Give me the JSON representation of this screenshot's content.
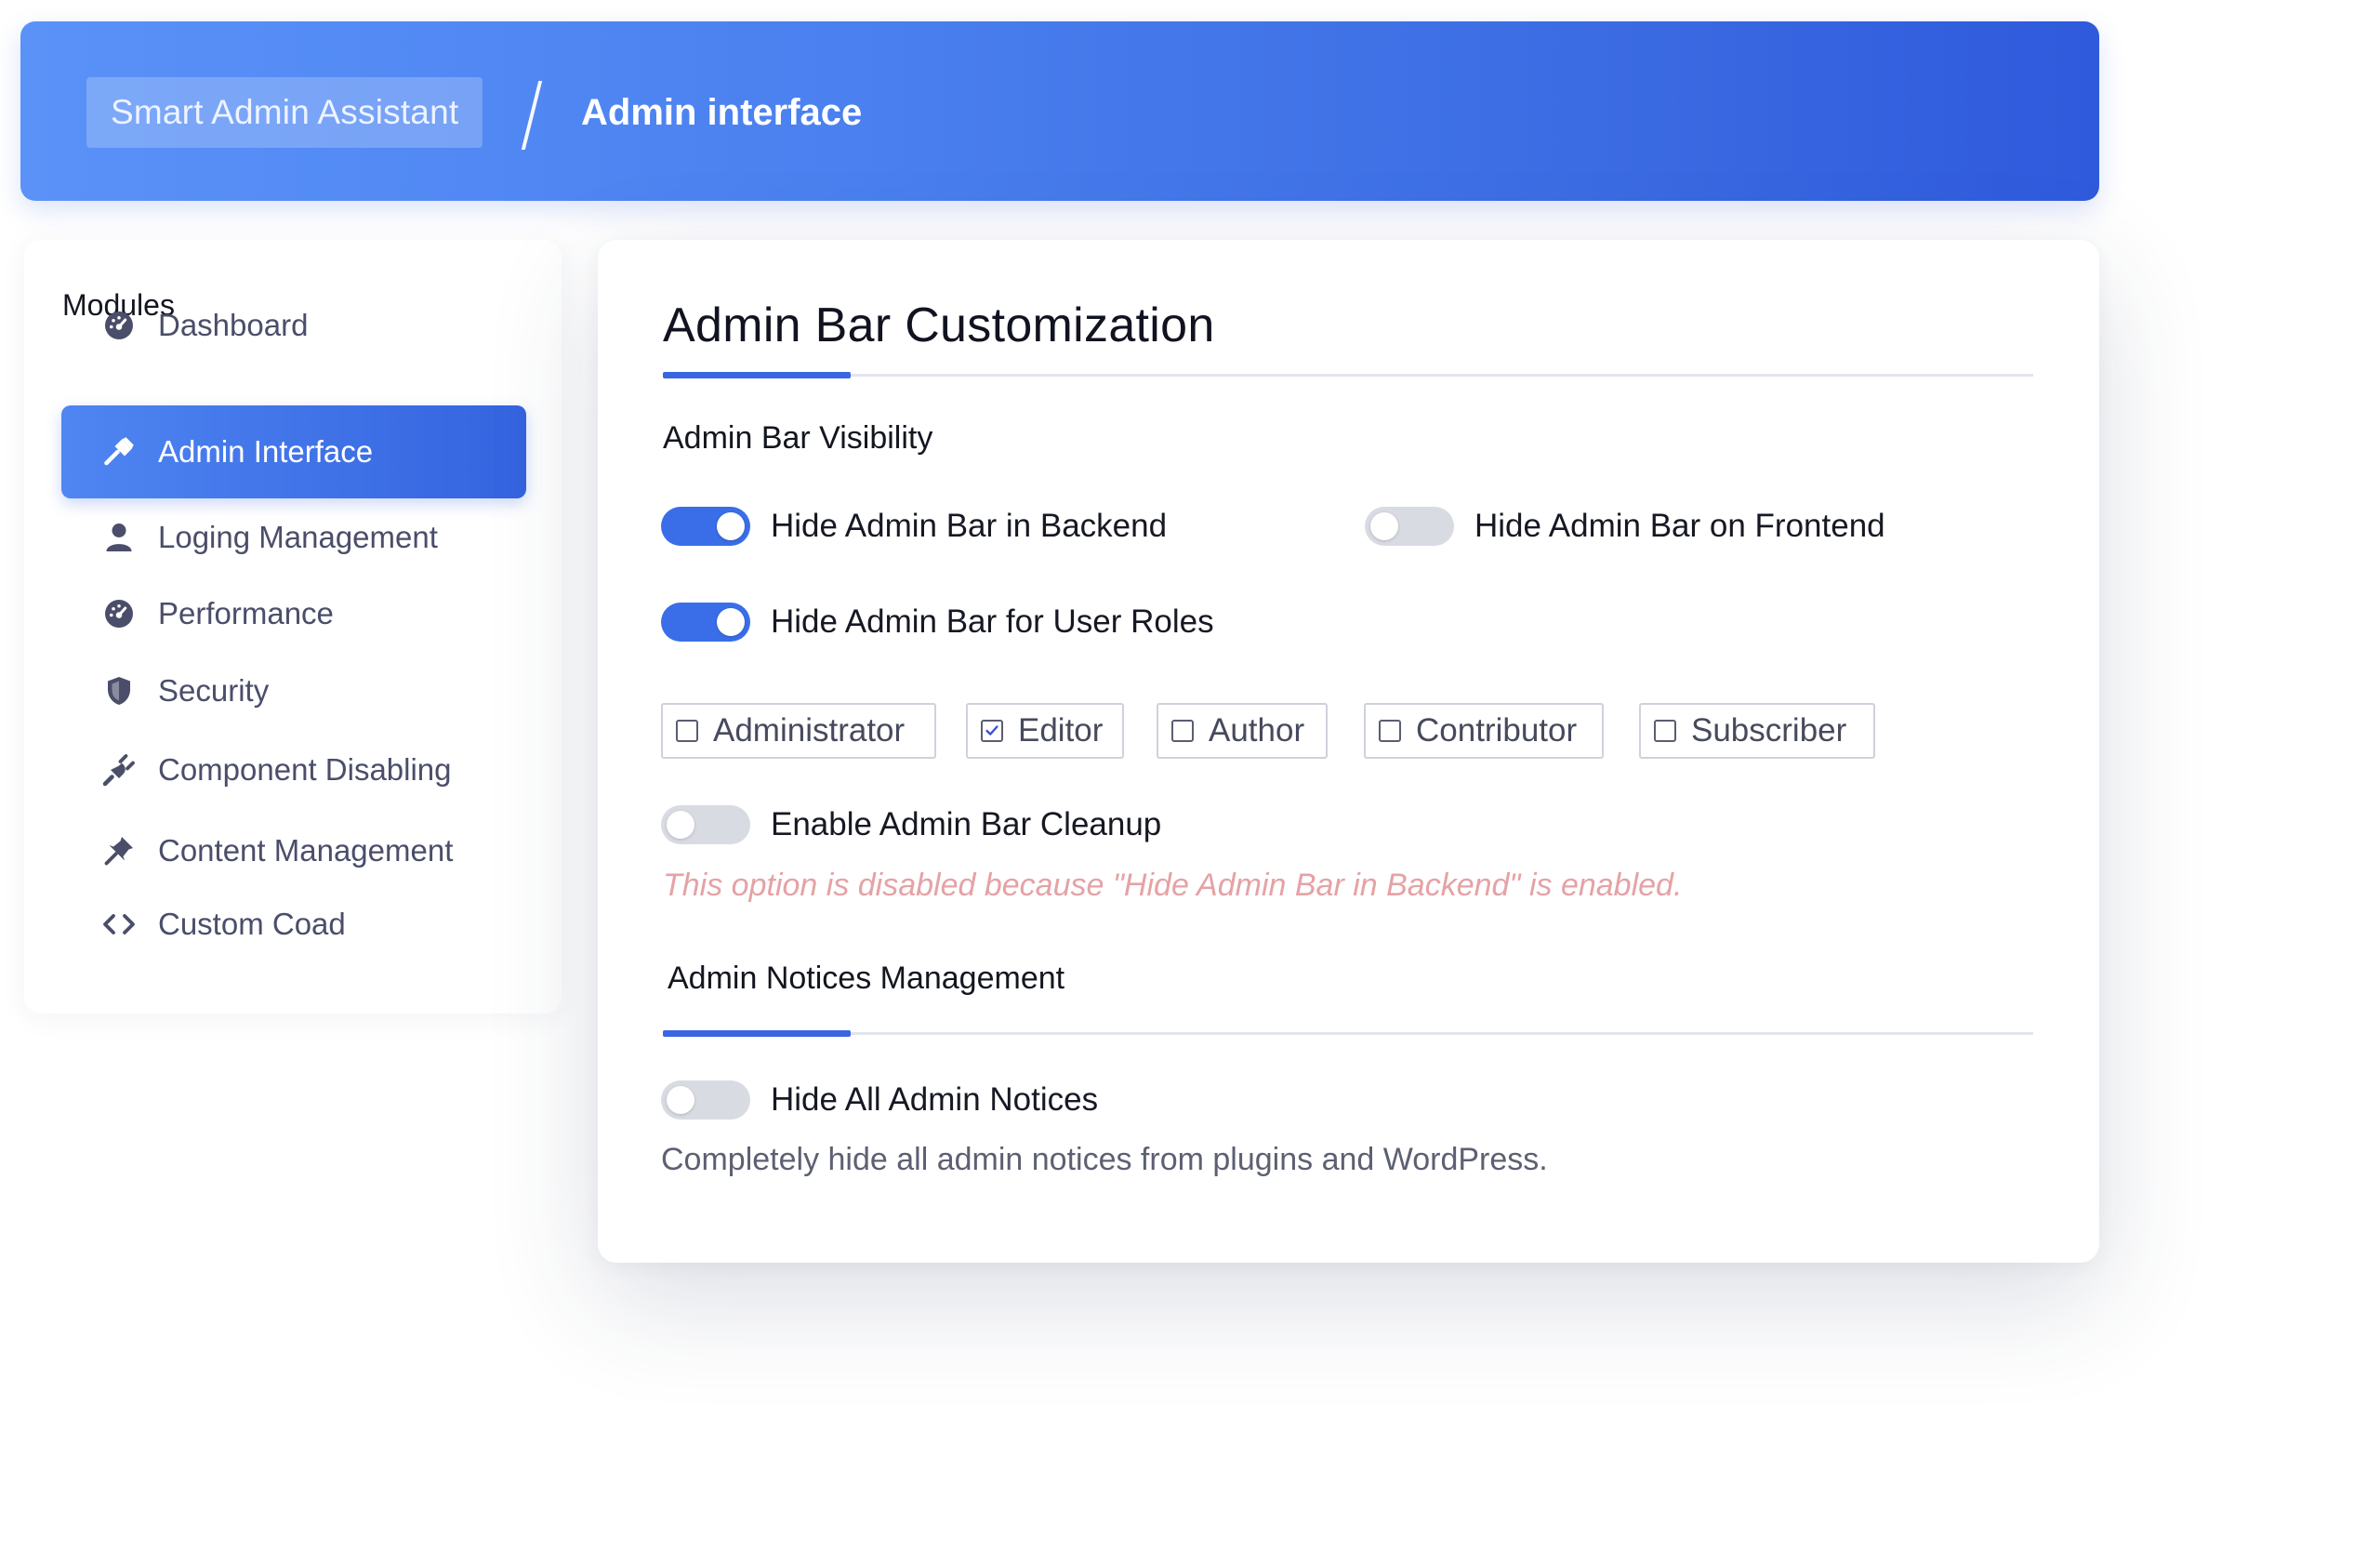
{
  "header": {
    "root_label": "Smart Admin Assistant",
    "current_label": "Admin interface"
  },
  "sidebar": {
    "title": "Modules",
    "items": [
      {
        "label": "Dashboard",
        "icon": "gauge-icon",
        "active": false
      },
      {
        "label": "Admin Interface",
        "icon": "hammer-icon",
        "active": true
      },
      {
        "label": "Loging Management",
        "icon": "user-icon",
        "active": false
      },
      {
        "label": "Performance",
        "icon": "gauge-icon",
        "active": false
      },
      {
        "label": "Security",
        "icon": "shield-icon",
        "active": false
      },
      {
        "label": "Component Disabling",
        "icon": "plug-icon",
        "active": false
      },
      {
        "label": "Content Management",
        "icon": "pin-icon",
        "active": false
      },
      {
        "label": "Custom Coad",
        "icon": "code-icon",
        "active": false
      }
    ]
  },
  "main": {
    "title": "Admin Bar Customization",
    "visibility_label": "Admin Bar Visibility",
    "toggles": {
      "hide_backend": {
        "label": "Hide Admin Bar in Backend",
        "on": true
      },
      "hide_frontend": {
        "label": "Hide Admin Bar on Frontend",
        "on": false
      },
      "hide_roles": {
        "label": "Hide Admin Bar for User Roles",
        "on": true
      },
      "cleanup": {
        "label": "Enable Admin Bar Cleanup",
        "on": false
      },
      "hide_notices": {
        "label": "Hide All Admin Notices",
        "on": false
      }
    },
    "roles": [
      {
        "label": "Administrator",
        "checked": false
      },
      {
        "label": "Editor",
        "checked": true
      },
      {
        "label": "Author",
        "checked": false
      },
      {
        "label": "Contributor",
        "checked": false
      },
      {
        "label": "Subscriber",
        "checked": false
      }
    ],
    "cleanup_warning": "This option is disabled because \"Hide Admin Bar in Backend\" is enabled.",
    "notices_title": "Admin Notices Management",
    "notices_hint": "Completely hide all admin notices from plugins and WordPress."
  },
  "colors": {
    "accent": "#3a6ee8",
    "warning_text": "#e5a2a6",
    "header_start": "#5a92f8",
    "header_end": "#2f5adc"
  }
}
